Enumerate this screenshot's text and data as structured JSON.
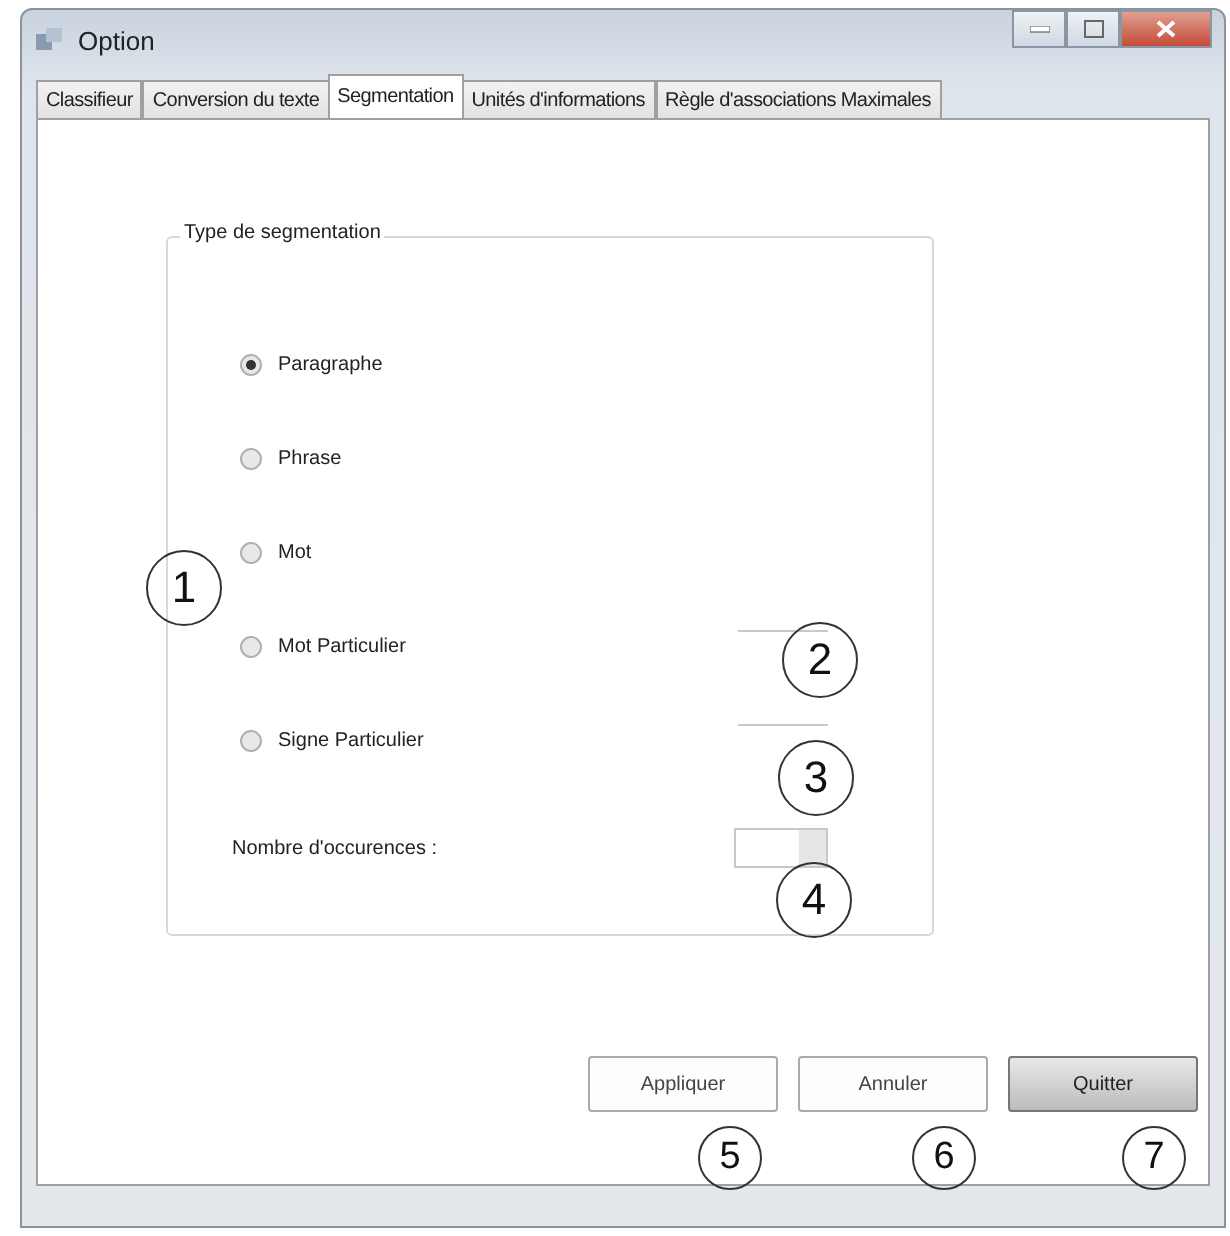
{
  "window": {
    "title": "Option"
  },
  "tabs": [
    {
      "label": "Classifieur",
      "selected": false
    },
    {
      "label": "Conversion du texte",
      "selected": false
    },
    {
      "label": "Segmentation",
      "selected": true
    },
    {
      "label": "Unités d'informations",
      "selected": false
    },
    {
      "label": "Règle d'associations Maximales",
      "selected": false
    }
  ],
  "group": {
    "title": "Type de segmentation",
    "options": [
      {
        "label": "Paragraphe",
        "selected": true,
        "field": false
      },
      {
        "label": "Phrase",
        "selected": false,
        "field": false
      },
      {
        "label": "Mot",
        "selected": false,
        "field": false
      },
      {
        "label": "Mot Particulier",
        "selected": false,
        "field": true
      },
      {
        "label": "Signe Particulier",
        "selected": false,
        "field": true
      }
    ],
    "count_label": "Nombre d'occurences :"
  },
  "buttons": [
    {
      "label": "Appliquer",
      "default": false
    },
    {
      "label": "Annuler",
      "default": false
    },
    {
      "label": "Quitter",
      "default": true
    }
  ],
  "callouts": [
    "1",
    "2",
    "3",
    "4",
    "5",
    "6",
    "7"
  ]
}
